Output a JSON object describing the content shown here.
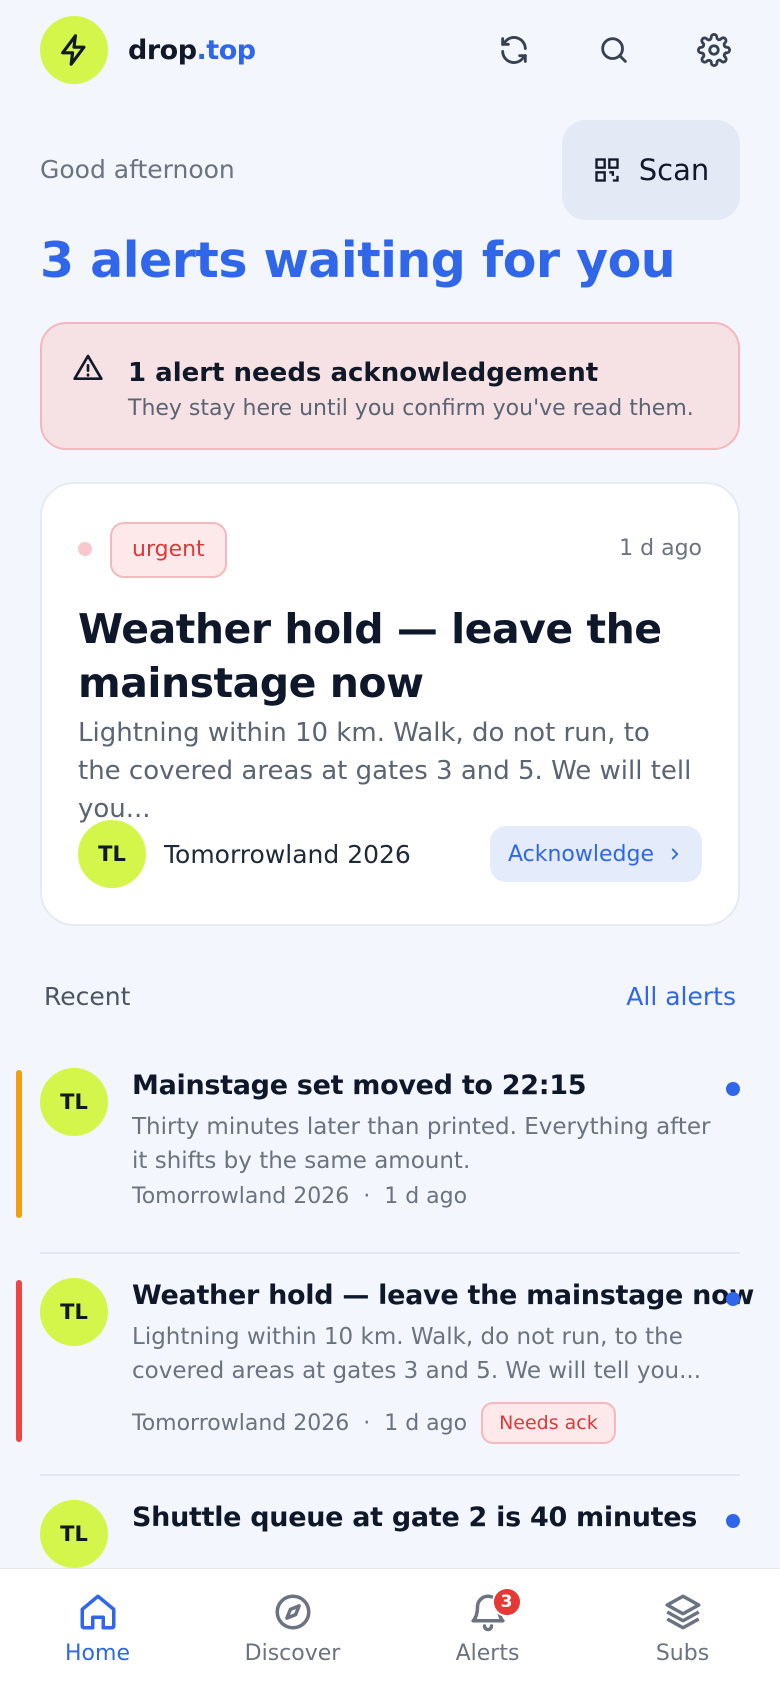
{
  "header": {
    "brand_part1": "drop",
    "brand_part2": ".top",
    "icons": [
      "lightning-icon",
      "refresh-icon",
      "search-icon",
      "gear-icon"
    ]
  },
  "greeting": "Good afternoon",
  "scan_label": "Scan",
  "headline": "3 alerts waiting for you",
  "ack_banner": {
    "title": "1 alert needs acknowledgement",
    "subtitle": "They stay here until you confirm you've read them."
  },
  "featured": {
    "tag": "urgent",
    "time": "1 d ago",
    "title": "Weather hold — leave the mainstage now",
    "body": "Lightning within 10 km. Walk, do not run, to the covered areas at gates 3 and 5. We will tell you...",
    "avatar": "TL",
    "source": "Tomorrowland 2026",
    "action": "Acknowledge"
  },
  "recent": {
    "label": "Recent",
    "all_link": "All alerts",
    "items": [
      {
        "avatar": "TL",
        "title": "Mainstage set moved to 22:15",
        "body": "Thirty minutes later than printed. Everything after it shifts by the same amount.",
        "source": "Tomorrowland 2026",
        "sep": "·",
        "time": "1 d ago",
        "bar_color": "#f59e0b"
      },
      {
        "avatar": "TL",
        "title": "Weather hold — leave the mainstage now",
        "body": "Lightning within 10 km. Walk, do not run, to the covered areas at gates 3 and 5. We will tell you...",
        "source": "Tomorrowland 2026",
        "sep": "·",
        "time": "1 d ago",
        "badge": "Needs ack",
        "bar_color": "#ef4444"
      },
      {
        "avatar": "TL",
        "title": "Shuttle queue at gate 2 is 40 minutes"
      }
    ]
  },
  "tabs": [
    {
      "label": "Home",
      "icon": "home-icon",
      "active": true
    },
    {
      "label": "Discover",
      "icon": "compass-icon"
    },
    {
      "label": "Alerts",
      "icon": "bell-icon",
      "badge": "3"
    },
    {
      "label": "Subs",
      "icon": "layers-icon"
    }
  ],
  "colors": {
    "accent": "#2f66ea",
    "lime": "#d4f64b",
    "danger": "#dc3a3a",
    "background": "#f3f6fd"
  }
}
